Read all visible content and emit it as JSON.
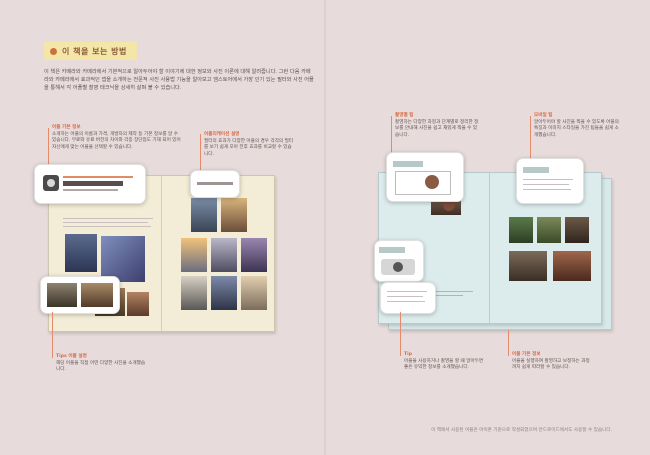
{
  "heading": {
    "title": "이 책을 보는 방법"
  },
  "intro": {
    "text": "이 책은 카메라와 카메라에서 기본적으로 알아두어야 할 이야기에 대한 정보와 사진 이론에 대해 알려줍니다. 그런 다음 카메라와 카메라에서 효과적인 앱을 소개하는 전문적 사진 사용법 기능을 알아보고 엠스토어에서 가장 인기 있는 필터와 사진 어플을 통해서 각 어플별 촬영 테크닉을 상세히 살펴 볼 수 있습니다."
  },
  "annotations": [
    {
      "title": "어플 기본 정보",
      "text": "소개하는 어플의 이름과 가격, 개발자의 제작 등 기본 정보를 알 수 있습니다. 무료와 유료 버전의 차이와 각종 장단점도 기재 되어 있어 자신에게 맞는 어플을 선택할 수 있습니다."
    },
    {
      "title": "어플리케이션 설명",
      "text": "필터의 효과가 다양한 어플의 경우 각각의 필터를 보기 쉽게 모아 전후 효과를 비교할 수 있습니다."
    },
    {
      "title": "Tips 어플 설명",
      "text": "해당 어플을 직접 어떤 다양한 사진을 소개했습니다."
    },
    {
      "title": "촬영별 팁",
      "text": "촬영하는 다양한 과정과 단계별로 정리한 정보를 안내해 사진을 쉽고 재밌게 찍을 수 있습니다."
    },
    {
      "title": "모바일 팁",
      "text": "알아두어야 할 사진을 찍을 수 있도록 어플의 특징과 이미지 스타일을 가진 팁들을 쉽게 소개했습니다."
    },
    {
      "title": "Tip",
      "text": "어플을 사용하거나 촬영을 할 때 알아두면 좋은 유익한 정보를 소개했습니다."
    },
    {
      "title": "어플 기본 정보",
      "text": "어플을 실행하여 촬영하고 보정하는 과정까지 쉽게 따라할 수 있습니다."
    }
  ],
  "footer": {
    "text": "이 책에서 사용된 어플은 아이폰 기준으로 작성되었으며 안드로이드에서도 사용할 수 있습니다."
  }
}
